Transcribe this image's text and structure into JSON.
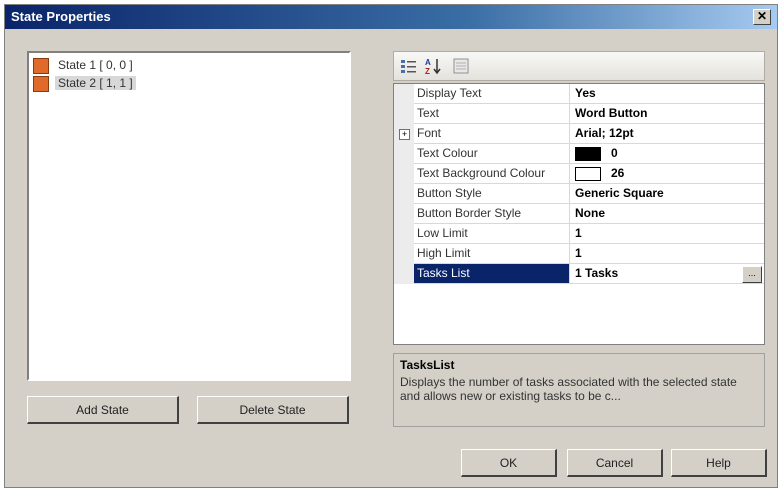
{
  "window": {
    "title": "State Properties",
    "close_glyph": "✕"
  },
  "states": [
    {
      "label": "State 1 [ 0, 0 ]",
      "color": "#e06a2c",
      "selected": false
    },
    {
      "label": "State 2 [ 1, 1 ]",
      "color": "#e06a2c",
      "selected": true
    }
  ],
  "buttons": {
    "add_state": "Add State",
    "delete_state": "Delete State",
    "ok": "OK",
    "cancel": "Cancel",
    "help": "Help"
  },
  "toolbar": {
    "categorized_icon": "categorized-icon",
    "alphabetical_icon": "alphabetical-sort-icon",
    "property_pages_icon": "property-pages-icon"
  },
  "properties": [
    {
      "name": "Display Text",
      "value": "Yes"
    },
    {
      "name": "Text",
      "value": "Word Button"
    },
    {
      "name": "Font",
      "value": "Arial; 12pt",
      "expandable": true,
      "expand_glyph": "+"
    },
    {
      "name": "Text Colour",
      "value": "0",
      "swatch": "#000000"
    },
    {
      "name": "Text Background Colour",
      "value": "26",
      "swatch": "#ffffff"
    },
    {
      "name": "Button Style",
      "value": "Generic Square"
    },
    {
      "name": "Button Border Style",
      "value": "None"
    },
    {
      "name": "Low Limit",
      "value": "1"
    },
    {
      "name": "High Limit",
      "value": "1"
    },
    {
      "name": "Tasks List",
      "value": "1 Tasks",
      "selected": true,
      "ellipsis": "..."
    }
  ],
  "description": {
    "title": "TasksList",
    "text": "Displays the number of tasks associated with the selected state and allows new or existing tasks to be c..."
  }
}
